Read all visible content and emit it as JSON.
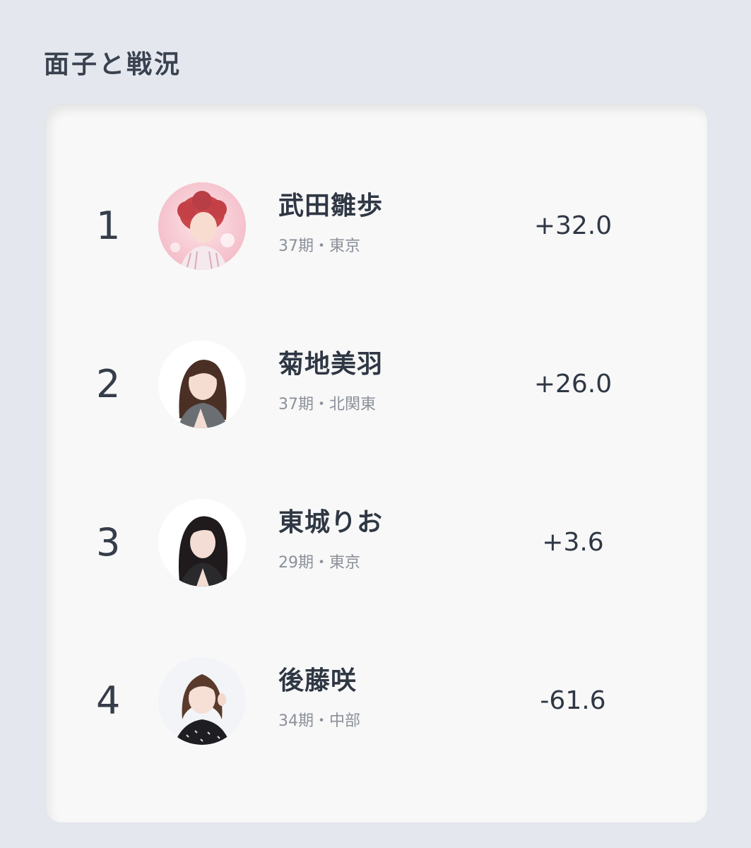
{
  "section": {
    "title": "面子と戦況"
  },
  "players": [
    {
      "rank": "1",
      "name": "武田雛歩",
      "meta": "37期・東京",
      "score": "+32.0",
      "avatar_icon": "player-photo-icon",
      "avatar_bg": "#f6c9d1"
    },
    {
      "rank": "2",
      "name": "菊地美羽",
      "meta": "37期・北関東",
      "score": "+26.0",
      "avatar_icon": "player-photo-icon",
      "avatar_bg": "#ffffff"
    },
    {
      "rank": "3",
      "name": "東城りお",
      "meta": "29期・東京",
      "score": "+3.6",
      "avatar_icon": "player-photo-icon",
      "avatar_bg": "#ffffff"
    },
    {
      "rank": "4",
      "name": "後藤咲",
      "meta": "34期・中部",
      "score": "-61.6",
      "avatar_icon": "player-photo-icon",
      "avatar_bg": "#f2f4f7"
    }
  ],
  "colors": {
    "page_background": "#e4e8ee",
    "card_background": "#f8f8f8",
    "text_primary": "#2f3744",
    "text_secondary": "#8b9099"
  }
}
